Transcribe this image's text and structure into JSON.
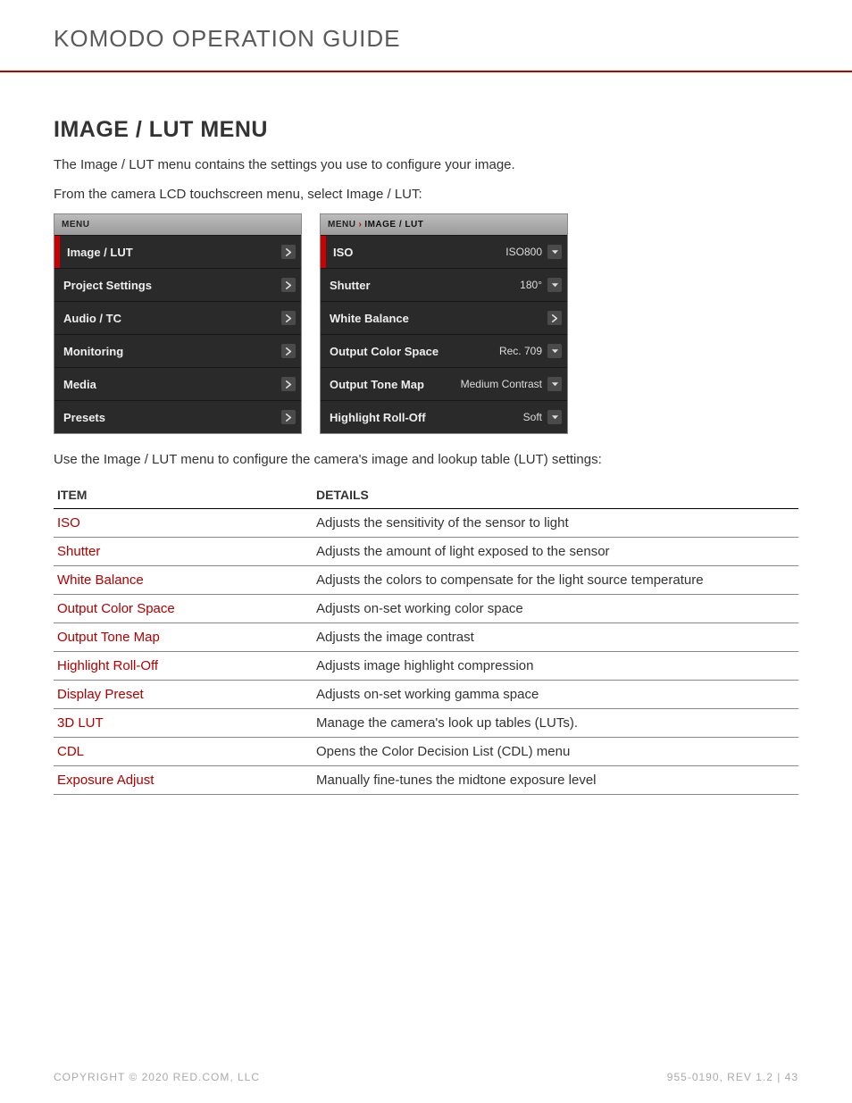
{
  "header": {
    "title": "KOMODO OPERATION GUIDE"
  },
  "section": {
    "title": "IMAGE / LUT MENU",
    "intro1": "The Image / LUT menu contains the settings you use to configure your image.",
    "intro2": "From the camera LCD touchscreen menu, select Image / LUT:",
    "afterMenus": "Use the Image / LUT menu to configure the camera's image and lookup table (LUT) settings:"
  },
  "menuLeft": {
    "header": "MENU",
    "items": [
      {
        "label": "Image / LUT",
        "selected": true
      },
      {
        "label": "Project Settings"
      },
      {
        "label": "Audio / TC"
      },
      {
        "label": "Monitoring"
      },
      {
        "label": "Media"
      },
      {
        "label": "Presets"
      }
    ]
  },
  "menuRight": {
    "crumbRoot": "MENU",
    "crumbLeaf": "IMAGE / LUT",
    "items": [
      {
        "label": "ISO",
        "value": "ISO800",
        "selected": true,
        "control": "dropdown"
      },
      {
        "label": "Shutter",
        "value": "180°",
        "control": "dropdown"
      },
      {
        "label": "White Balance",
        "value": "",
        "control": "chevron"
      },
      {
        "label": "Output Color Space",
        "value": "Rec. 709",
        "control": "dropdown"
      },
      {
        "label": "Output Tone Map",
        "value": "Medium Contrast",
        "control": "dropdown"
      },
      {
        "label": "Highlight Roll-Off",
        "value": "Soft",
        "control": "dropdown"
      }
    ]
  },
  "table": {
    "headers": {
      "item": "ITEM",
      "details": "DETAILS"
    },
    "rows": [
      {
        "item": "ISO",
        "details": "Adjusts the sensitivity of the sensor to light"
      },
      {
        "item": "Shutter",
        "details": "Adjusts the amount of light exposed to the sensor"
      },
      {
        "item": "White Balance",
        "details": "Adjusts the colors to compensate for the light source temperature"
      },
      {
        "item": "Output Color Space",
        "details": "Adjusts on-set working color space"
      },
      {
        "item": "Output Tone Map",
        "details": "Adjusts the image contrast"
      },
      {
        "item": "Highlight Roll-Off",
        "details": "Adjusts image highlight compression"
      },
      {
        "item": "Display Preset",
        "details": "Adjusts on-set working gamma space"
      },
      {
        "item": "3D LUT",
        "details": "Manage the camera's look up tables (LUTs)."
      },
      {
        "item": "CDL",
        "details": "Opens the Color Decision List (CDL) menu"
      },
      {
        "item": "Exposure Adjust",
        "details": "Manually fine-tunes the midtone exposure level"
      }
    ]
  },
  "footer": {
    "left": "COPYRIGHT © 2020 RED.COM, LLC",
    "right": "955-0190, REV 1.2  |  43"
  }
}
